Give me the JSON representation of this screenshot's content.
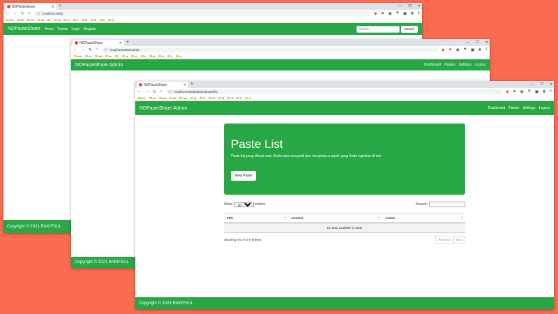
{
  "windows": [
    {
      "tab_title": "NDPasteShare",
      "url": "localhost:3000",
      "brand": "NDPasteShare",
      "nav_left": [
        "Home",
        "Trends",
        "Login",
        "Register"
      ],
      "search_placeholder": "Search",
      "search_button": "Search",
      "footer": "Copyright © 2021 RAKIFSUL"
    },
    {
      "tab_title": "NDPasteShare",
      "url": "localhost:3000/admin",
      "brand": "NDPasteShare Admin",
      "nav_right": [
        "Dashboard",
        "Pastes",
        "Settings",
        "Logout"
      ],
      "footer": "Copyright © 2021 RAKIFSUL"
    },
    {
      "tab_title": "NDPasteShare",
      "url": "localhost:3000/admin/paste/list",
      "brand": "NDPasteShare Admin",
      "nav_right": [
        "Dashboard",
        "Pastes",
        "Settings",
        "Logout"
      ],
      "footer": "Copyright © 2021 RAKIFSUL",
      "jumbotron": {
        "title": "Paste List",
        "subtitle": "Paste list yang dibuat user. Anda bisa mengedit dan menghapus paste yang Anda inginkan di sini.",
        "button": "New Paste"
      },
      "datatable": {
        "show_label": "Show",
        "length_value": "10",
        "entries_label": "entries",
        "search_label": "Search:",
        "columns": [
          "Title",
          "Content",
          "Action"
        ],
        "empty_message": "No data available in table",
        "info": "Showing 0 to 0 of 0 entries",
        "prev": "Previous",
        "next": "Next"
      }
    }
  ],
  "bookmarks": [
    "ent",
    "lrn",
    "wrl",
    "dc",
    "",
    "qi",
    "ct",
    "ti",
    "dt",
    "dl",
    "tt",
    "ul"
  ],
  "bookmarks_w3": [
    "ent",
    "lrn",
    "wrl",
    "dc",
    "ww",
    "qi",
    "ct",
    "bt",
    "dt",
    "dl",
    "tt",
    "ul"
  ],
  "colors": {
    "background": "#fa6c4f",
    "accent": "#28a745"
  }
}
